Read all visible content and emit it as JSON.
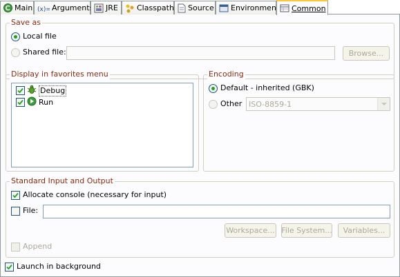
{
  "tabs": [
    {
      "label": "Main",
      "icon": "main-tab-icon"
    },
    {
      "label": "Arguments",
      "icon": "arguments-icon"
    },
    {
      "label": "JRE",
      "icon": "jre-icon"
    },
    {
      "label": "Classpath",
      "icon": "classpath-icon"
    },
    {
      "label": "Source",
      "icon": "source-icon"
    },
    {
      "label": "Environment",
      "icon": "environment-icon"
    },
    {
      "label": "Common",
      "icon": "common-icon",
      "active": true
    }
  ],
  "save_as": {
    "title": "Save as",
    "local_file_label": "Local file",
    "local_file_selected": true,
    "shared_file_label": "Shared file:",
    "shared_file_value": "",
    "browse_label": "Browse..."
  },
  "favorites": {
    "title": "Display in favorites menu",
    "items": [
      {
        "label": "Debug",
        "checked": true,
        "icon": "debug-icon"
      },
      {
        "label": "Run",
        "checked": true,
        "icon": "run-icon"
      }
    ]
  },
  "encoding": {
    "title": "Encoding",
    "default_label": "Default - inherited (GBK)",
    "default_selected": true,
    "other_label": "Other",
    "other_value": "ISO-8859-1"
  },
  "std_io": {
    "title": "Standard Input and Output",
    "allocate_console_label": "Allocate console (necessary for input)",
    "allocate_console_checked": true,
    "file_label": "File:",
    "file_checked": false,
    "file_value": "",
    "workspace_label": "Workspace...",
    "file_system_label": "File System...",
    "variables_label": "Variables...",
    "append_label": "Append",
    "append_checked": false
  },
  "launch_background": {
    "label": "Launch in background",
    "checked": true
  },
  "colors": {
    "group_title": "#8b2a0e",
    "active_tab_accent": "#ffc83c",
    "check_mark": "#21a121"
  }
}
